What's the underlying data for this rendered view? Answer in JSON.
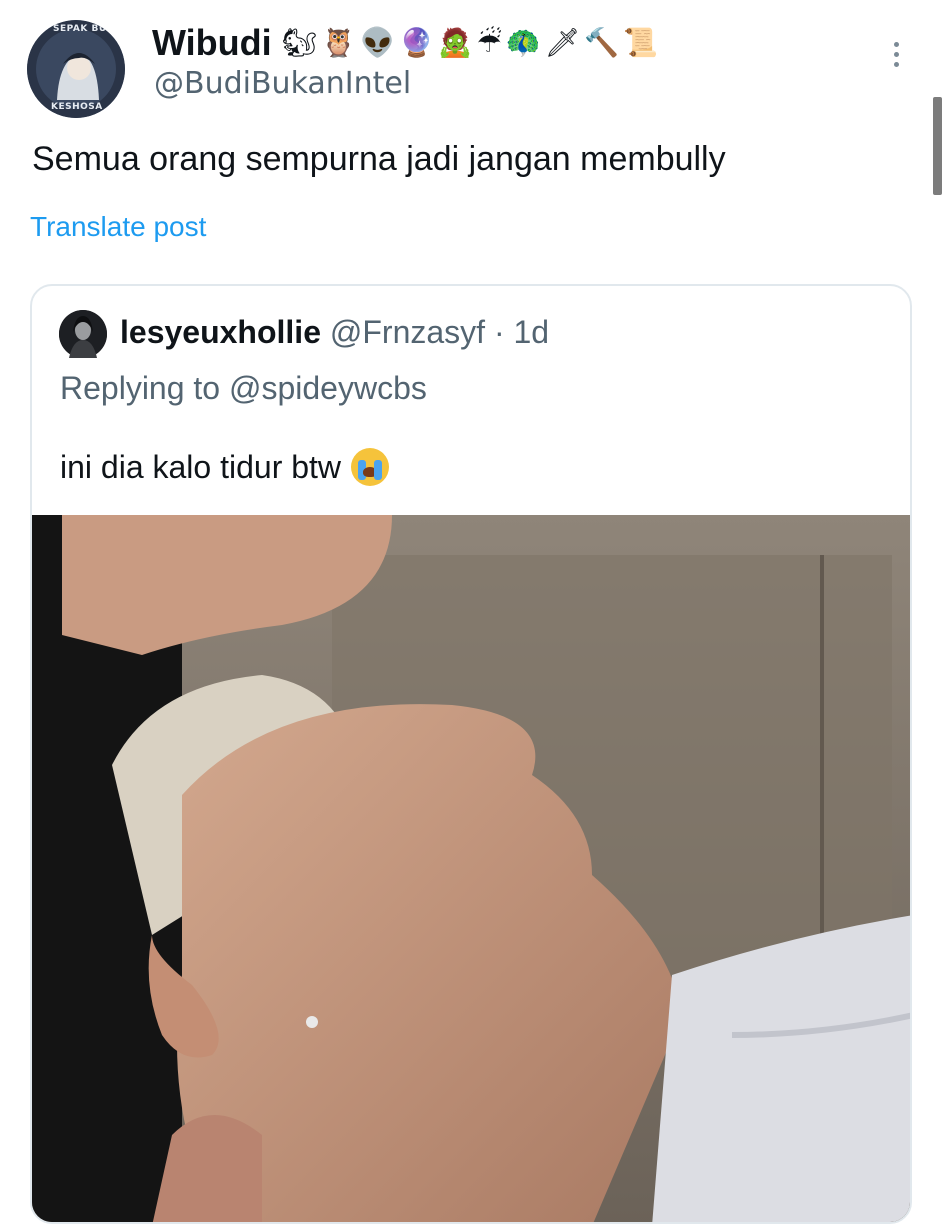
{
  "post": {
    "author": {
      "display_name": "Wibudi",
      "name_emojis": [
        "🐿",
        "🦉",
        "👽",
        "🔮",
        "🧟",
        "☔",
        "🦚",
        "🗡",
        "🔨",
        "📜"
      ],
      "handle": "@BudiBukanIntel",
      "avatar_badge_top": "SEPAK BUMI",
      "avatar_badge_bottom": "KESHOSA"
    },
    "text": "Semua orang sempurna jadi jangan membully",
    "translate_label": "Translate post"
  },
  "quoted_post": {
    "author": {
      "display_name": "lesyeuxhollie",
      "handle": "@Frnzasyf",
      "separator": "·",
      "time": "1d"
    },
    "replying_to": "Replying to @spideywcbs",
    "text": "ini dia kalo tidur btw",
    "emoji": "crying-face"
  },
  "icons": {
    "more": "more-vertical-icon"
  },
  "colors": {
    "link": "#1d9bf0",
    "secondary_text": "#536471",
    "primary_text": "#0f1419",
    "border": "#e1e8ed"
  }
}
